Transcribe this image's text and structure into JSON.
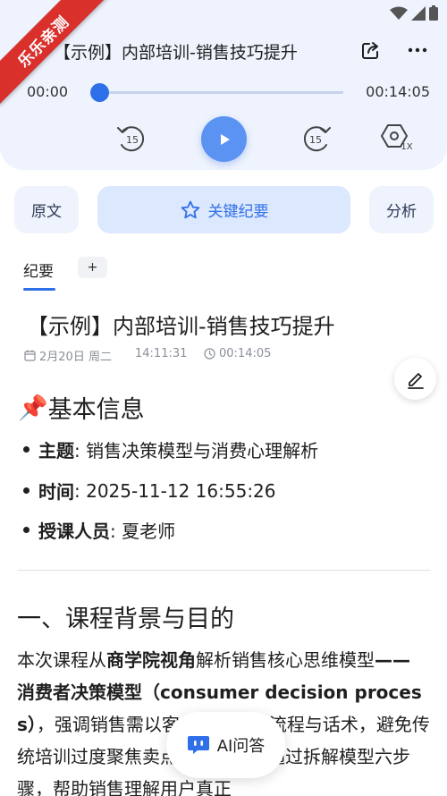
{
  "ribbon": {
    "label": "乐乐亲测"
  },
  "player": {
    "title": "【示例】内部培训-销售技巧提升",
    "current_time": "00:00",
    "total_time": "00:14:05",
    "progress": 0,
    "rewind_seconds": "15",
    "forward_seconds": "15",
    "speed_label": "1X"
  },
  "tabs": {
    "original": "原文",
    "key_summary": "关键纪要",
    "analysis": "分析"
  },
  "subtabs": {
    "summary": "纪要",
    "add": "+"
  },
  "doc": {
    "title": "【示例】内部培训-销售技巧提升",
    "date": "2月20日 周二",
    "time": "14:11:31",
    "duration": "00:14:05",
    "section_icon": "📌",
    "section_title": "基本信息",
    "info": [
      {
        "label": "主题",
        "value": ": 销售决策模型与消费心理解析"
      },
      {
        "label": "时间",
        "value": ": 2025-11-12 16:55:26"
      },
      {
        "label": "授课人员",
        "value": ": 夏老师"
      }
    ],
    "h2": "一、课程背景与目的",
    "para": {
      "p1": "本次课程从",
      "b1": "商学院视角",
      "p2": "解析销售核心思维模型",
      "b2": "—— 消费者决策模型（consumer decision process）",
      "p3": "，强调销售需以客户视角设计流程与话术，避免传统培训过度聚焦卖点的误区；并通过拆解模型六步骤，帮助销售理解用户真正"
    }
  },
  "ai_button": {
    "label": "AI问答"
  },
  "colors": {
    "accent": "#2f6fe8",
    "ribbon": "#d9302c",
    "player_bg": "#eef3fd"
  }
}
